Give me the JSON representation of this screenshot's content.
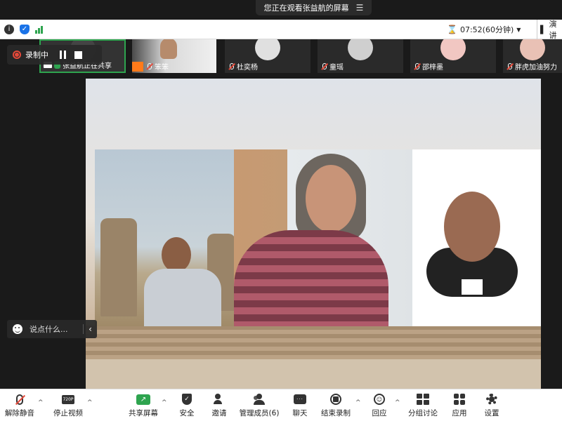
{
  "banner": {
    "text": "您正在观看张益航的屏幕"
  },
  "topbar": {
    "timer": "07:52(60分钟)",
    "view_label": "演讲"
  },
  "recording": {
    "label": "录制中"
  },
  "participants": [
    {
      "name": "张益航正在共享",
      "mic": "on"
    },
    {
      "name": "笨笨",
      "mic": "off"
    },
    {
      "name": "杜奕杨",
      "mic": "off"
    },
    {
      "name": "童瑶",
      "mic": "off"
    },
    {
      "name": "邵梓墨",
      "mic": "off"
    },
    {
      "name": "胖虎加油努力",
      "mic": "off"
    }
  ],
  "chat": {
    "placeholder": "说点什么..."
  },
  "toolbar": {
    "unmute": "解除静音",
    "stop_video": "停止视频",
    "camera_badge": "720P",
    "share_screen": "共享屏幕",
    "security": "安全",
    "invite": "邀请",
    "members": "管理成员(6)",
    "chat": "聊天",
    "end_recording": "结束录制",
    "reactions": "回应",
    "breakout": "分组讨论",
    "apps": "应用",
    "settings": "设置"
  },
  "colors": {
    "accent_green": "#2ea44f",
    "record_red": "#e5493a",
    "shield_blue": "#1a73e8"
  }
}
